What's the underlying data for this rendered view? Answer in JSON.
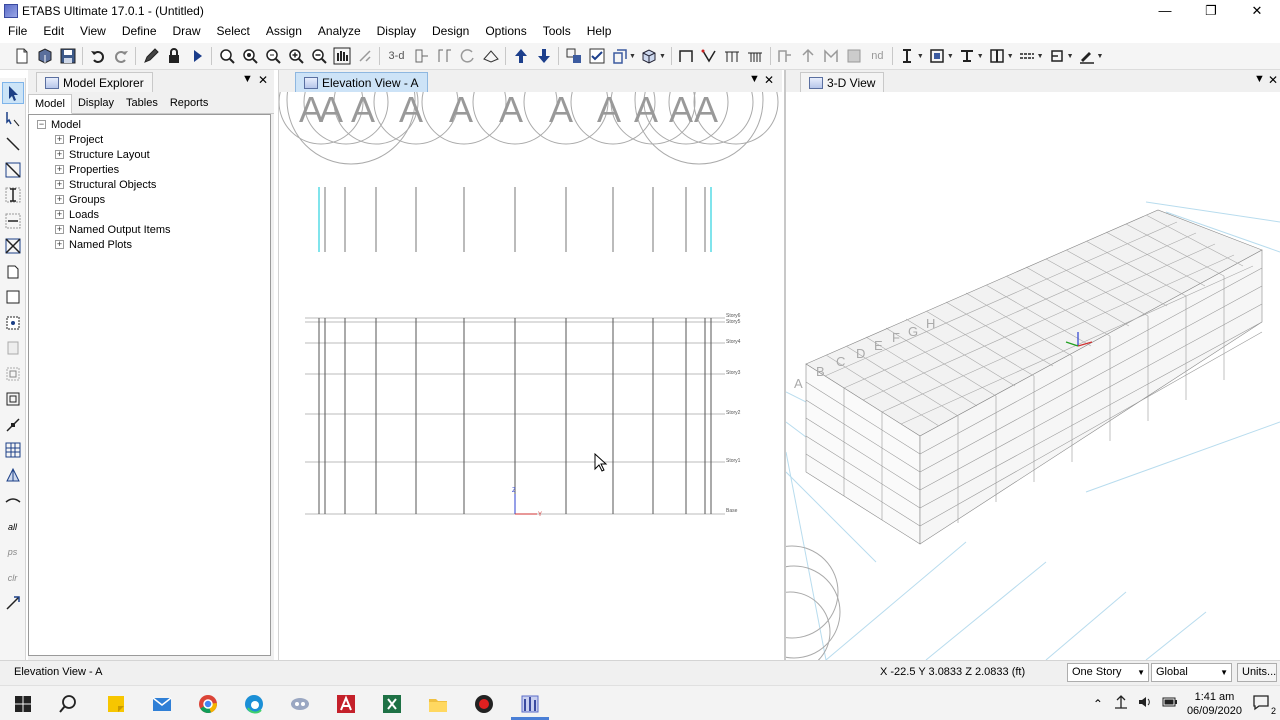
{
  "window": {
    "title": "ETABS Ultimate 17.0.1 - (Untitled)",
    "minimize": "—",
    "restore": "❐",
    "close": "✕"
  },
  "menu": [
    "File",
    "Edit",
    "View",
    "Define",
    "Draw",
    "Select",
    "Assign",
    "Analyze",
    "Display",
    "Design",
    "Options",
    "Tools",
    "Help"
  ],
  "toolbar": {
    "view_3d_label": "3-d",
    "nd_label": "nd"
  },
  "left_tools": {
    "all_label": "all",
    "ps_label": "ps",
    "clr_label": "clr"
  },
  "explorer": {
    "title": "Model Explorer",
    "tabs": [
      "Model",
      "Display",
      "Tables",
      "Reports"
    ],
    "active_tab": "Model",
    "root": "Model",
    "items": [
      "Project",
      "Structure Layout",
      "Properties",
      "Structural Objects",
      "Groups",
      "Loads",
      "Named Output Items",
      "Named Plots"
    ]
  },
  "elevation_view": {
    "title": "Elevation View - A",
    "stories": [
      "Story6",
      "Story5",
      "Story4",
      "Story3",
      "Story2",
      "Story1",
      "Base"
    ],
    "axis_z": "Z",
    "axis_y": "Y"
  },
  "view_3d": {
    "title": "3-D View",
    "grid_labels": [
      "A",
      "B",
      "C",
      "D",
      "E",
      "F",
      "G",
      "H"
    ]
  },
  "status": {
    "text": "Elevation View - A",
    "coords": "X -22.5  Y 3.0833  Z 2.0833 (ft)",
    "story_select": "One Story",
    "coord_select": "Global",
    "units_button": "Units..."
  },
  "taskbar": {
    "time": "1:41 am",
    "date": "06/09/2020",
    "notifications": "2"
  },
  "colors": {
    "accent": "#cde3f7",
    "taskbar_active": "#4a7fd6",
    "elevation_highlight": "#00c8d8"
  }
}
